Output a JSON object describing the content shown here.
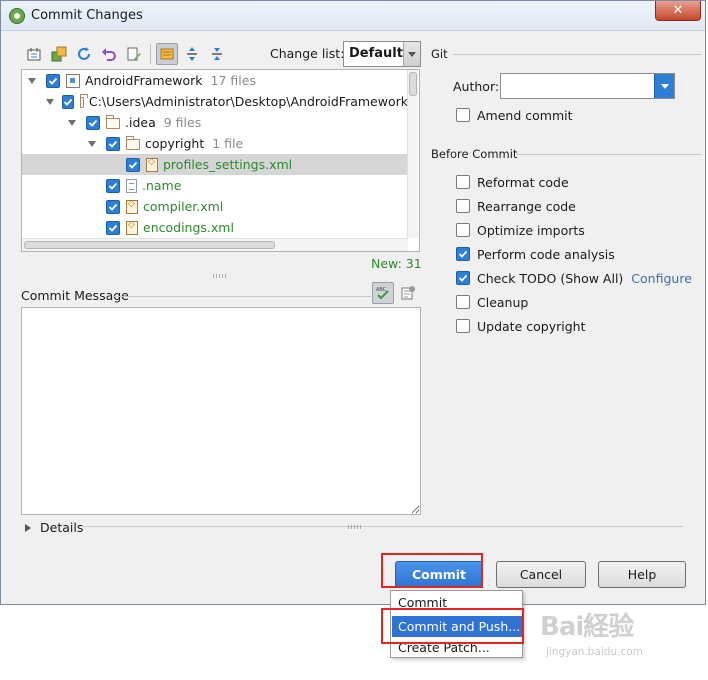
{
  "window": {
    "title": "Commit Changes",
    "close_glyph": "✕"
  },
  "toolbar": {
    "icons": [
      "diff-icon",
      "move-to-changelist-icon",
      "refresh-icon",
      "rollback-icon",
      "edit-source-icon",
      "group-by-directory-icon",
      "expand-all-icon",
      "collapse-all-icon"
    ]
  },
  "changelist": {
    "label": "Change list:",
    "value": "Default"
  },
  "tree": {
    "rows": [
      {
        "name": "AndroidFramework",
        "count": "17 files",
        "icon": "module"
      },
      {
        "name": "C:\\Users\\Administrator\\Desktop\\AndroidFramework",
        "count": "",
        "icon": "folder"
      },
      {
        "name": ".idea",
        "count": "9 files",
        "icon": "folder"
      },
      {
        "name": "copyright",
        "count": "1 file",
        "icon": "folder"
      },
      {
        "name": "profiles_settings.xml",
        "count": "",
        "icon": "xml"
      },
      {
        "name": ".name",
        "count": "",
        "icon": "text"
      },
      {
        "name": "compiler.xml",
        "count": "",
        "icon": "xml"
      },
      {
        "name": "encodings.xml",
        "count": "",
        "icon": "xml"
      }
    ],
    "new_count": "New: 31"
  },
  "commit_message": {
    "label": "Commit Message",
    "value": ""
  },
  "git": {
    "section_label": "Git",
    "author_label": "Author:",
    "author_value": "",
    "amend_label": "Amend commit",
    "amend_checked": false
  },
  "before_commit": {
    "section_label": "Before Commit",
    "options": [
      {
        "label": "Reformat code",
        "checked": false
      },
      {
        "label": "Rearrange code",
        "checked": false
      },
      {
        "label": "Optimize imports",
        "checked": false
      },
      {
        "label": "Perform code analysis",
        "checked": true
      },
      {
        "label": "Check TODO (Show All)",
        "checked": true,
        "link": "Configure"
      },
      {
        "label": "Cleanup",
        "checked": false
      },
      {
        "label": "Update copyright",
        "checked": false
      }
    ]
  },
  "details": {
    "label": "Details"
  },
  "buttons": {
    "commit": "Commit",
    "cancel": "Cancel",
    "help": "Help"
  },
  "commit_menu": {
    "items": [
      "Commit",
      "Commit and Push...",
      "Create Patch..."
    ],
    "highlighted_index": 1
  },
  "watermark": {
    "logo": "Bai経验",
    "url": "jingyan.baidu.com"
  },
  "colors": {
    "accent": "#2f74d2",
    "new_text": "#2a8a2a",
    "highlight_box": "#e22626",
    "link": "#3a6fb0"
  }
}
